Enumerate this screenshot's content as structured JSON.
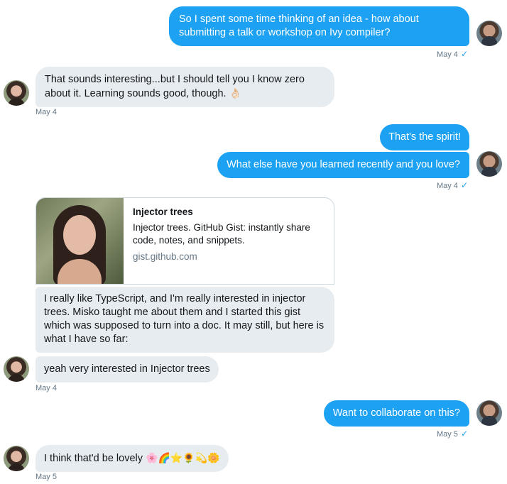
{
  "messages": {
    "m1": {
      "text": "So I spent some time thinking of an idea - how about submitting a talk or workshop on Ivy compiler?",
      "time": "May 4",
      "check": "✓"
    },
    "m2": {
      "text": "That sounds interesting...but I should tell you I know zero about it. Learning sounds good, though.",
      "emoji": "👌🏻",
      "time": "May 4"
    },
    "m3": {
      "text": "That's the spirit!"
    },
    "m4": {
      "text": "What else have you learned recently and you love?",
      "time": "May 4",
      "check": "✓"
    },
    "card": {
      "title": "Injector trees",
      "description": "Injector trees. GitHub Gist: instantly share code, notes, and snippets.",
      "url": "gist.github.com"
    },
    "m5": {
      "text": "I really like TypeScript, and I'm really interested in injector trees. Misko taught me about them and I started this gist which was supposed to turn into a doc. It may still, but here is what I have so far:"
    },
    "m6": {
      "text": "yeah very interested in Injector trees",
      "time": "May 4"
    },
    "m7": {
      "text": "Want to collaborate on this?",
      "time": "May 5",
      "check": "✓"
    },
    "m8": {
      "text": "I think that'd be lovely",
      "emoji": "🌸🌈⭐🌻💫🌼",
      "time": "May 5"
    }
  }
}
